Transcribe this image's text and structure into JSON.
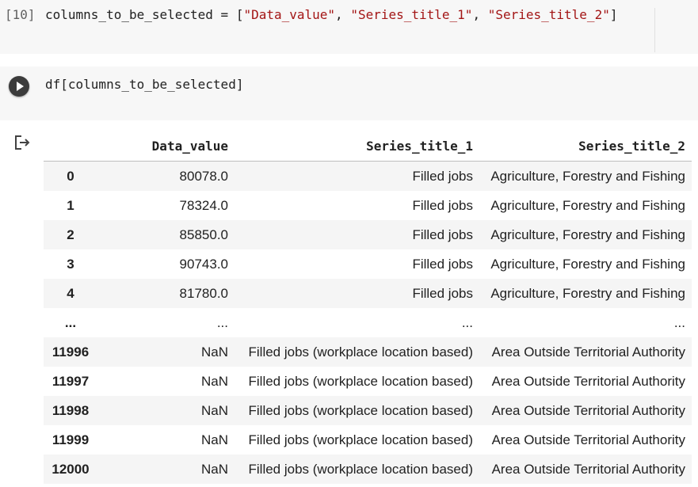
{
  "cell1": {
    "exec_count": "[10]",
    "code_prefix": "columns_to_be_selected = [",
    "code_items": [
      "\"Data_value\"",
      "\"Series_title_1\"",
      "\"Series_title_2\""
    ],
    "code_sep": ", ",
    "code_suffix": "]"
  },
  "cell2": {
    "code": "df[columns_to_be_selected]"
  },
  "output": {
    "columns": [
      "",
      "Data_value",
      "Series_title_1",
      "Series_title_2"
    ],
    "rows": [
      {
        "index": "0",
        "data_value": "80078.0",
        "series_title_1": "Filled jobs",
        "series_title_2": "Agriculture, Forestry and Fishing"
      },
      {
        "index": "1",
        "data_value": "78324.0",
        "series_title_1": "Filled jobs",
        "series_title_2": "Agriculture, Forestry and Fishing"
      },
      {
        "index": "2",
        "data_value": "85850.0",
        "series_title_1": "Filled jobs",
        "series_title_2": "Agriculture, Forestry and Fishing"
      },
      {
        "index": "3",
        "data_value": "90743.0",
        "series_title_1": "Filled jobs",
        "series_title_2": "Agriculture, Forestry and Fishing"
      },
      {
        "index": "4",
        "data_value": "81780.0",
        "series_title_1": "Filled jobs",
        "series_title_2": "Agriculture, Forestry and Fishing"
      },
      {
        "index": "...",
        "data_value": "...",
        "series_title_1": "...",
        "series_title_2": "..."
      },
      {
        "index": "11996",
        "data_value": "NaN",
        "series_title_1": "Filled jobs (workplace location based)",
        "series_title_2": "Area Outside Territorial Authority"
      },
      {
        "index": "11997",
        "data_value": "NaN",
        "series_title_1": "Filled jobs (workplace location based)",
        "series_title_2": "Area Outside Territorial Authority"
      },
      {
        "index": "11998",
        "data_value": "NaN",
        "series_title_1": "Filled jobs (workplace location based)",
        "series_title_2": "Area Outside Territorial Authority"
      },
      {
        "index": "11999",
        "data_value": "NaN",
        "series_title_1": "Filled jobs (workplace location based)",
        "series_title_2": "Area Outside Territorial Authority"
      },
      {
        "index": "12000",
        "data_value": "NaN",
        "series_title_1": "Filled jobs (workplace location based)",
        "series_title_2": "Area Outside Territorial Authority"
      }
    ]
  },
  "icons": {
    "run": "play-circle-icon",
    "output": "output-arrow-icon"
  }
}
